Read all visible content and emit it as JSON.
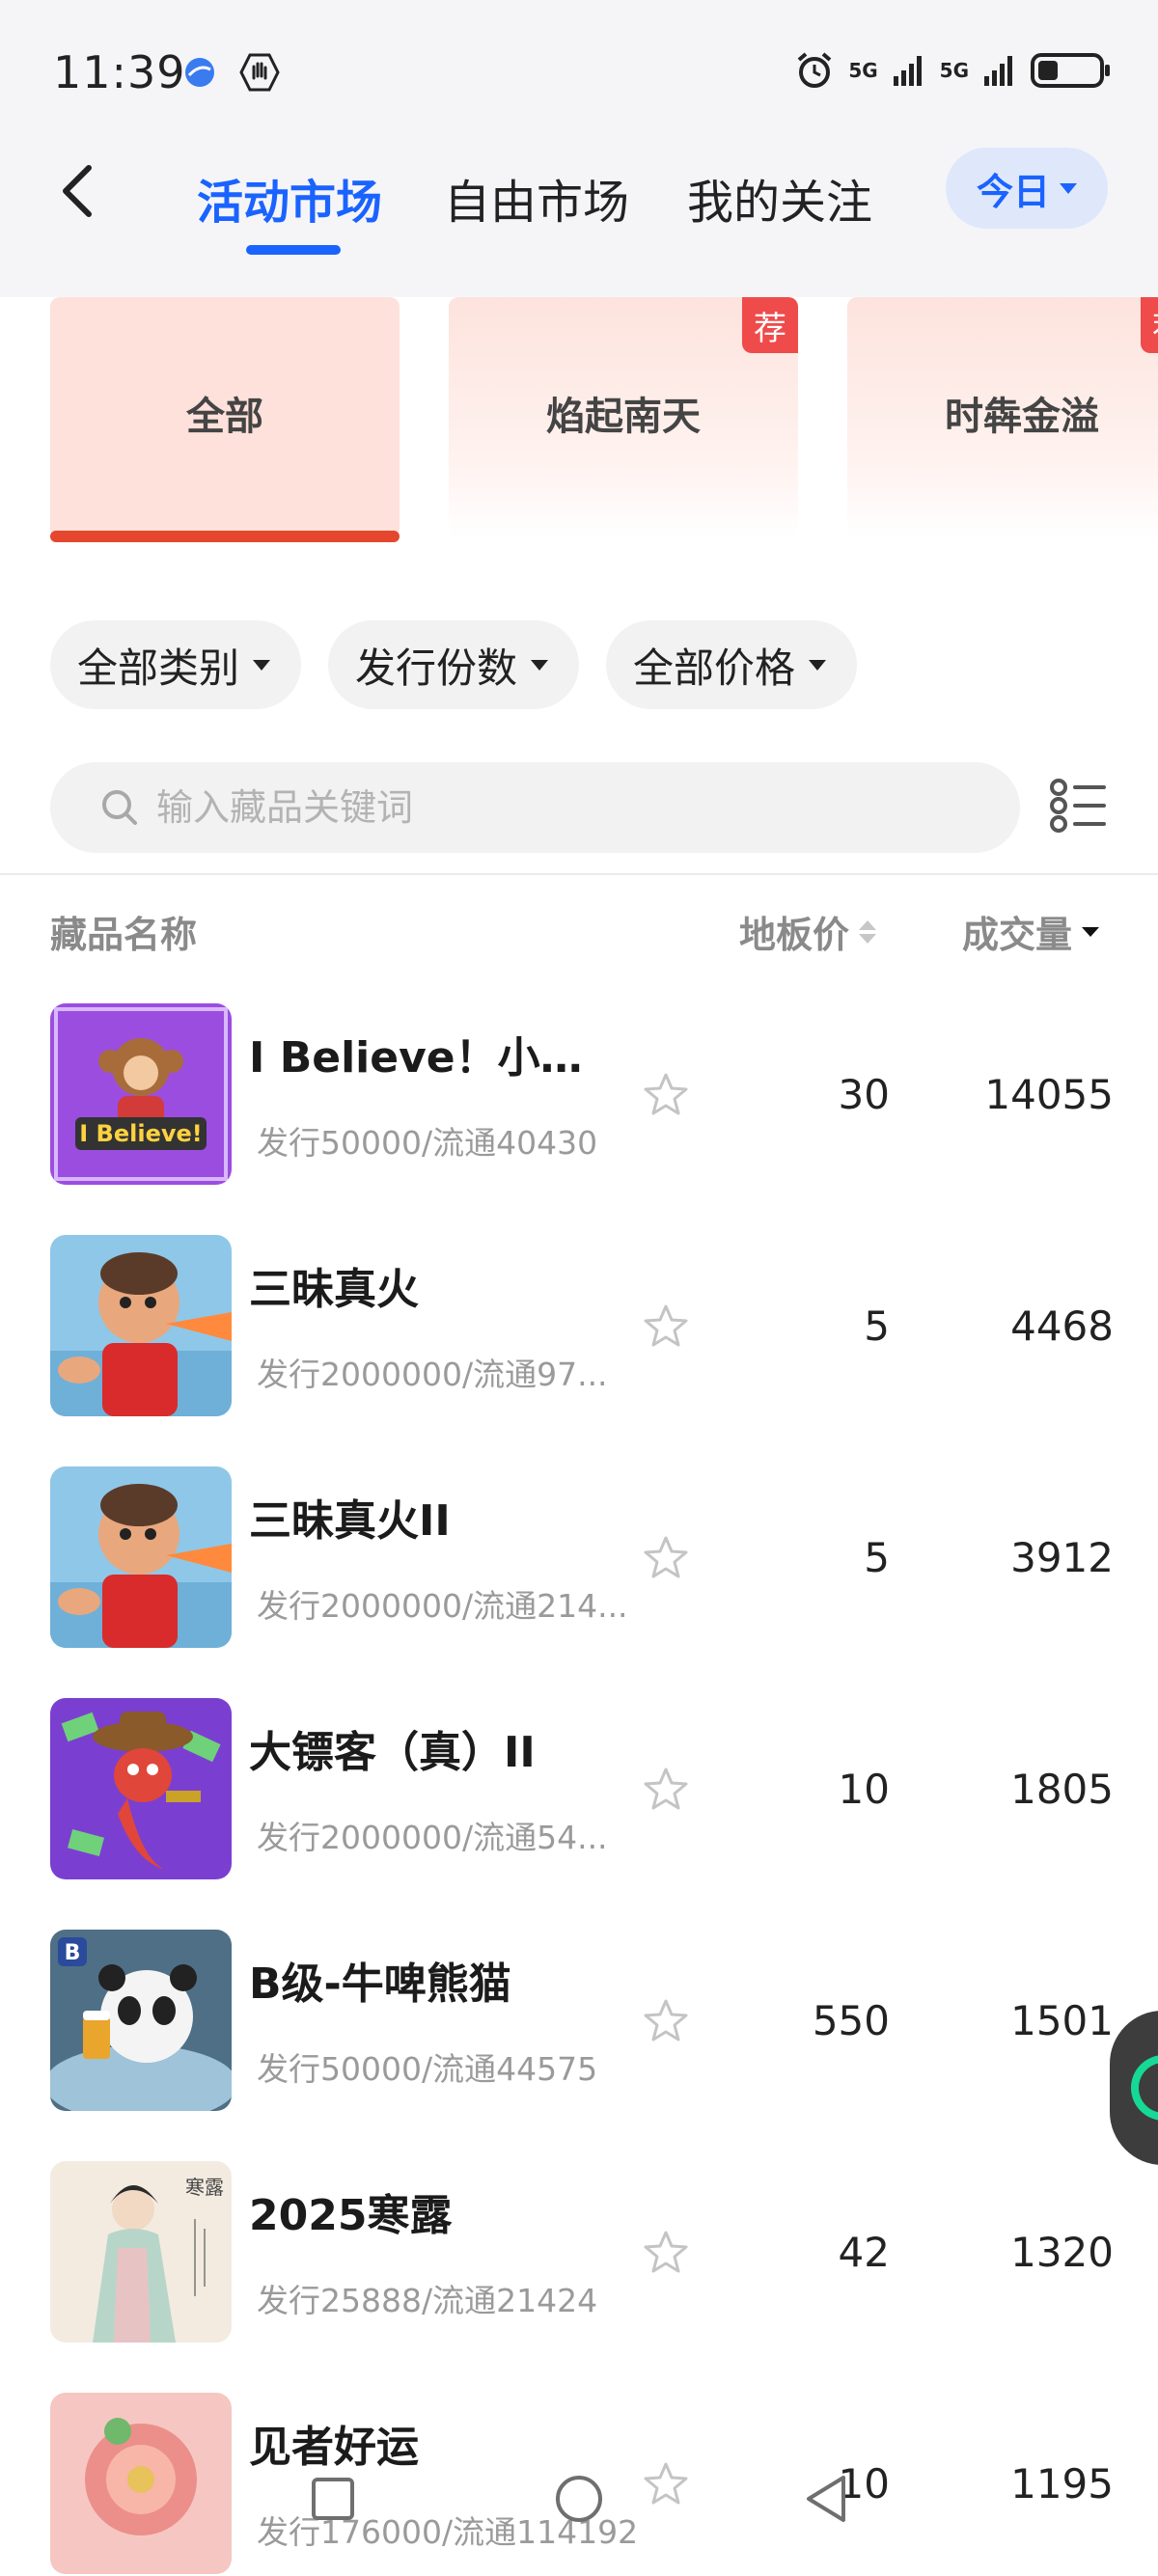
{
  "status": {
    "time": "11:39",
    "network_1": "5G",
    "network_2": "5G"
  },
  "header": {
    "tabs": [
      {
        "label": "活动市场",
        "active": true
      },
      {
        "label": "自由市场",
        "active": false
      },
      {
        "label": "我的关注",
        "active": false
      }
    ],
    "date_filter": "今日",
    "accent_color": "#1a63ff"
  },
  "categories": [
    {
      "label": "全部",
      "active": true,
      "badge": ""
    },
    {
      "label": "焰起南天",
      "active": false,
      "badge": "荐"
    },
    {
      "label": "时犇金溢",
      "active": false,
      "badge": "荐"
    }
  ],
  "filters": [
    "全部类别",
    "发行份数",
    "全部价格"
  ],
  "search": {
    "placeholder": "输入藏品关键词"
  },
  "table_header": {
    "name": "藏品名称",
    "floor_price": "地板价",
    "volume": "成交量"
  },
  "items": [
    {
      "name": "I Believe！小红...",
      "meta": "发行50000/流通40430",
      "price": "30",
      "volume": "14055",
      "thumb_text": "I Believe!"
    },
    {
      "name": "三昧真火",
      "meta": "发行2000000/流通97...",
      "price": "5",
      "volume": "4468"
    },
    {
      "name": "三昧真火II",
      "meta": "发行2000000/流通214...",
      "price": "5",
      "volume": "3912"
    },
    {
      "name": "大镖客（真）II",
      "meta": "发行2000000/流通54...",
      "price": "10",
      "volume": "1805"
    },
    {
      "name": "B级-牛啤熊猫",
      "meta": "发行50000/流通44575",
      "price": "550",
      "volume": "1501",
      "thumb_text": "B"
    },
    {
      "name": "2025寒露",
      "meta": "发行25888/流通21424",
      "price": "42",
      "volume": "1320",
      "thumb_text": "寒露"
    },
    {
      "name": "见者好运",
      "meta": "发行176000/流通114192",
      "price": "10",
      "volume": "1195"
    }
  ]
}
